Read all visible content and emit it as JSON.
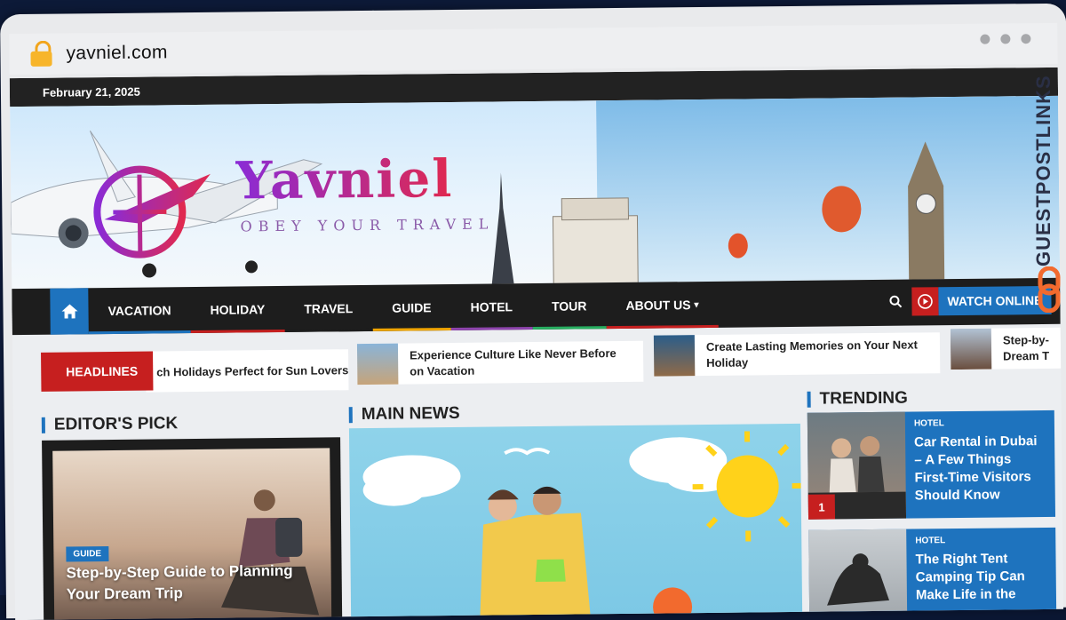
{
  "browser": {
    "url": "yavniel.com"
  },
  "topbar": {
    "date": "February 21, 2025"
  },
  "logo": {
    "name": "Yavniel",
    "tagline": "OBEY YOUR TRAVEL"
  },
  "nav": {
    "items": [
      {
        "label": "VACATION",
        "color": "#1e73be"
      },
      {
        "label": "HOLIDAY",
        "color": "#c61f1f"
      },
      {
        "label": "TRAVEL",
        "color": "#1d1d1d"
      },
      {
        "label": "GUIDE",
        "color": "#f0a500"
      },
      {
        "label": "HOTEL",
        "color": "#8e44ad"
      },
      {
        "label": "TOUR",
        "color": "#27ae60"
      },
      {
        "label": "ABOUT US",
        "color": "#c61f1f"
      }
    ],
    "watch_label": "WATCH ONLINE"
  },
  "ticker": {
    "label": "HEADLINES",
    "items": [
      "ch Holidays Perfect for Sun Lovers",
      "Experience Culture Like Never Before on Vacation",
      "Create Lasting Memories on Your Next Holiday",
      "Step-by-Step Guide to Planning Your Dream Trip"
    ],
    "item4_visible": "Step-by- Dream T"
  },
  "editors_pick": {
    "title": "EDITOR'S PICK",
    "card": {
      "category": "GUIDE",
      "headline": "Step-by-Step Guide to Planning Your Dream Trip"
    }
  },
  "main_news": {
    "title": "MAIN NEWS"
  },
  "trending": {
    "title": "TRENDING",
    "items": [
      {
        "rank": "1",
        "category": "HOTEL",
        "headline": "Car Rental in Dubai – A Few Things First-Time Visitors Should Know"
      },
      {
        "category": "HOTEL",
        "headline": "The Right Tent Camping Tip Can Make Life in the"
      }
    ]
  },
  "watermark": {
    "text": "GUESTPOSTLINKS"
  },
  "colors": {
    "accent": "#1e73be",
    "red": "#c61f1f",
    "dark": "#1d1d1d"
  }
}
